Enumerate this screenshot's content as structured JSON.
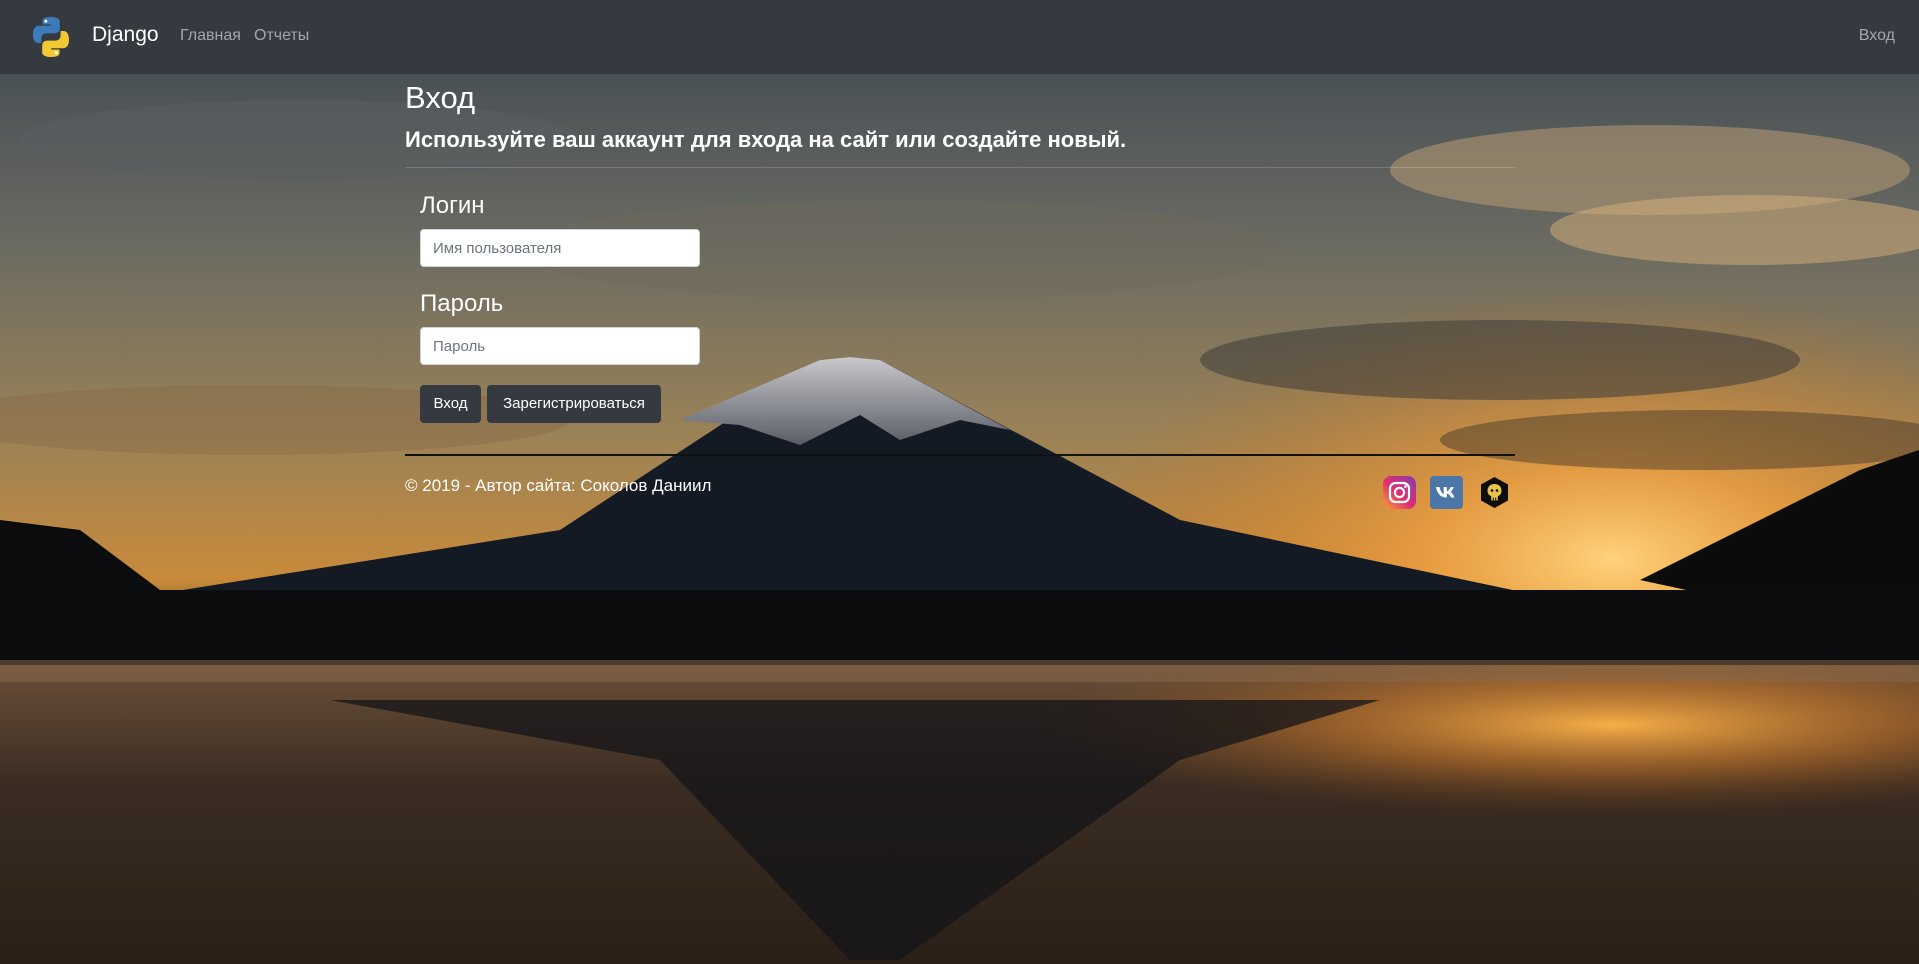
{
  "navbar": {
    "brand": "Django",
    "links": [
      {
        "label": "Главная"
      },
      {
        "label": "Отчеты"
      }
    ],
    "login_label": "Вход",
    "background": "#343a40"
  },
  "page": {
    "title": "Вход",
    "subtitle": "Используйте ваш аккаунт для входа на сайт или создайте новый."
  },
  "form": {
    "login_label": "Логин",
    "login_placeholder": "Имя пользователя",
    "login_value": "",
    "password_label": "Пароль",
    "password_placeholder": "Пароль",
    "password_value": "",
    "submit_label": "Вход",
    "register_label": "Зарегистрироваться"
  },
  "footer": {
    "text": "© 2019 - Автор сайта: Соколов Даниил",
    "social": [
      {
        "icon": "instagram-icon"
      },
      {
        "icon": "vk-icon"
      },
      {
        "icon": "github-icon"
      }
    ]
  },
  "background_image": {
    "subject": "mountain-at-sunset-over-lake"
  }
}
